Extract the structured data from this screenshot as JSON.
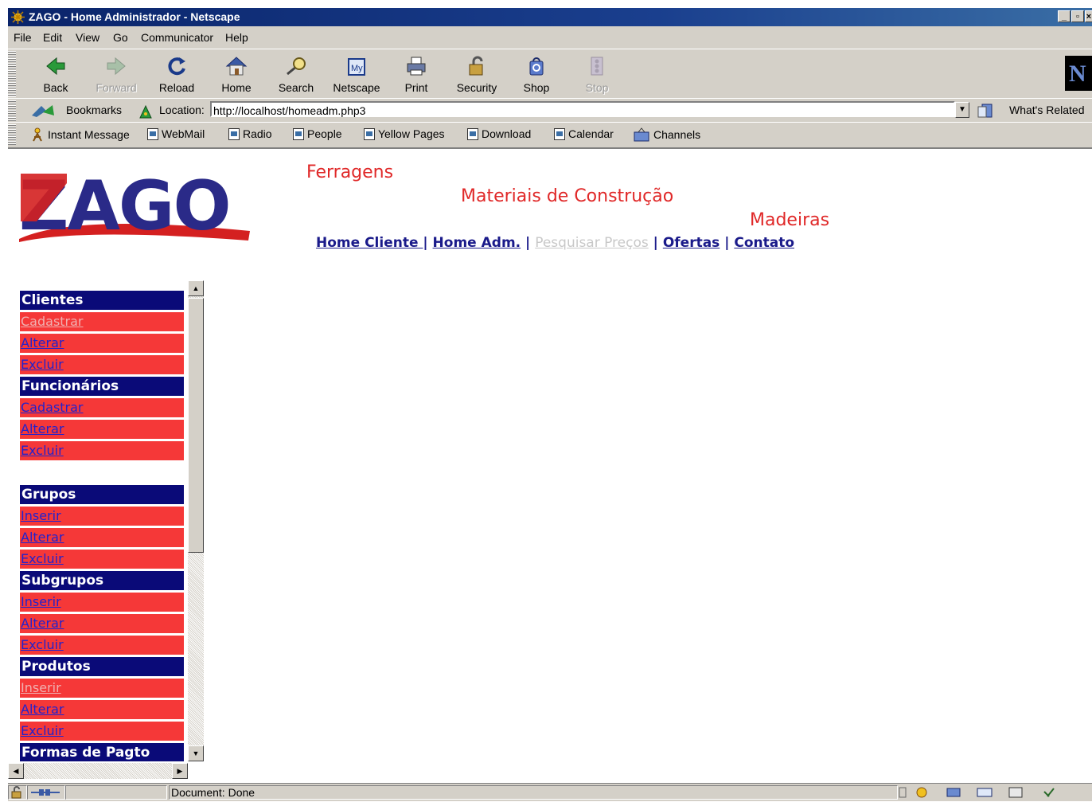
{
  "window": {
    "title": "ZAGO - Home Administrador - Netscape"
  },
  "menu": [
    "File",
    "Edit",
    "View",
    "Go",
    "Communicator",
    "Help"
  ],
  "toolbar": [
    {
      "label": "Back",
      "icon": "back-arrow-icon",
      "enabled": true
    },
    {
      "label": "Forward",
      "icon": "forward-arrow-icon",
      "enabled": false
    },
    {
      "label": "Reload",
      "icon": "reload-icon",
      "enabled": true
    },
    {
      "label": "Home",
      "icon": "home-icon",
      "enabled": true
    },
    {
      "label": "Search",
      "icon": "search-icon",
      "enabled": true
    },
    {
      "label": "Netscape",
      "icon": "my-netscape-icon",
      "enabled": true
    },
    {
      "label": "Print",
      "icon": "printer-icon",
      "enabled": true
    },
    {
      "label": "Security",
      "icon": "padlock-icon",
      "enabled": true
    },
    {
      "label": "Shop",
      "icon": "shopping-bag-icon",
      "enabled": true
    },
    {
      "label": "Stop",
      "icon": "stop-icon",
      "enabled": false
    }
  ],
  "location": {
    "bookmarks_label": "Bookmarks",
    "location_label": "Location:",
    "url": "http://localhost/homeadm.php3",
    "whats_related": "What's Related"
  },
  "personal_toolbar": [
    "Instant Message",
    "WebMail",
    "Radio",
    "People",
    "Yellow Pages",
    "Download",
    "Calendar",
    "Channels"
  ],
  "page": {
    "logo_text": "ZAGO",
    "taglines": [
      "Ferragens",
      "Materiais de Construção",
      "Madeiras"
    ],
    "topnav": [
      {
        "label": "Home Cliente ",
        "visited": false
      },
      {
        "label": "Home Adm.",
        "visited": false
      },
      {
        "label": "Pesquisar Preços",
        "visited": true
      },
      {
        "label": "Ofertas",
        "visited": false
      },
      {
        "label": "Contato",
        "visited": false
      }
    ],
    "topnav_separator": "|"
  },
  "sidebar": {
    "sections": [
      {
        "title": "Clientes",
        "items": [
          {
            "label": "Cadastrar",
            "visited": true
          },
          {
            "label": "Alterar",
            "visited": false
          },
          {
            "label": "Excluir",
            "visited": false
          }
        ]
      },
      {
        "title": "Funcionários",
        "items": [
          {
            "label": "Cadastrar",
            "visited": false
          },
          {
            "label": "Alterar",
            "visited": false
          },
          {
            "label": "Excluir",
            "visited": false
          }
        ]
      },
      {
        "title": "Grupos",
        "items": [
          {
            "label": "Inserir",
            "visited": false
          },
          {
            "label": "Alterar",
            "visited": false
          },
          {
            "label": "Excluir",
            "visited": false
          }
        ]
      },
      {
        "title": "Subgrupos",
        "items": [
          {
            "label": "Inserir",
            "visited": false
          },
          {
            "label": "Alterar",
            "visited": false
          },
          {
            "label": "Excluir",
            "visited": false
          }
        ]
      },
      {
        "title": "Produtos",
        "items": [
          {
            "label": "Inserir",
            "visited": true
          },
          {
            "label": "Alterar",
            "visited": false
          },
          {
            "label": "Excluir",
            "visited": false
          }
        ]
      },
      {
        "title": "Formas de Pagto",
        "items": []
      }
    ]
  },
  "status": {
    "text": "Document: Done"
  },
  "colors": {
    "section_bg": "#0a0a78",
    "item_bg": "#f53838",
    "tagline": "#e02828",
    "link": "#1a1a8a",
    "visited": "#c8c8c8"
  }
}
